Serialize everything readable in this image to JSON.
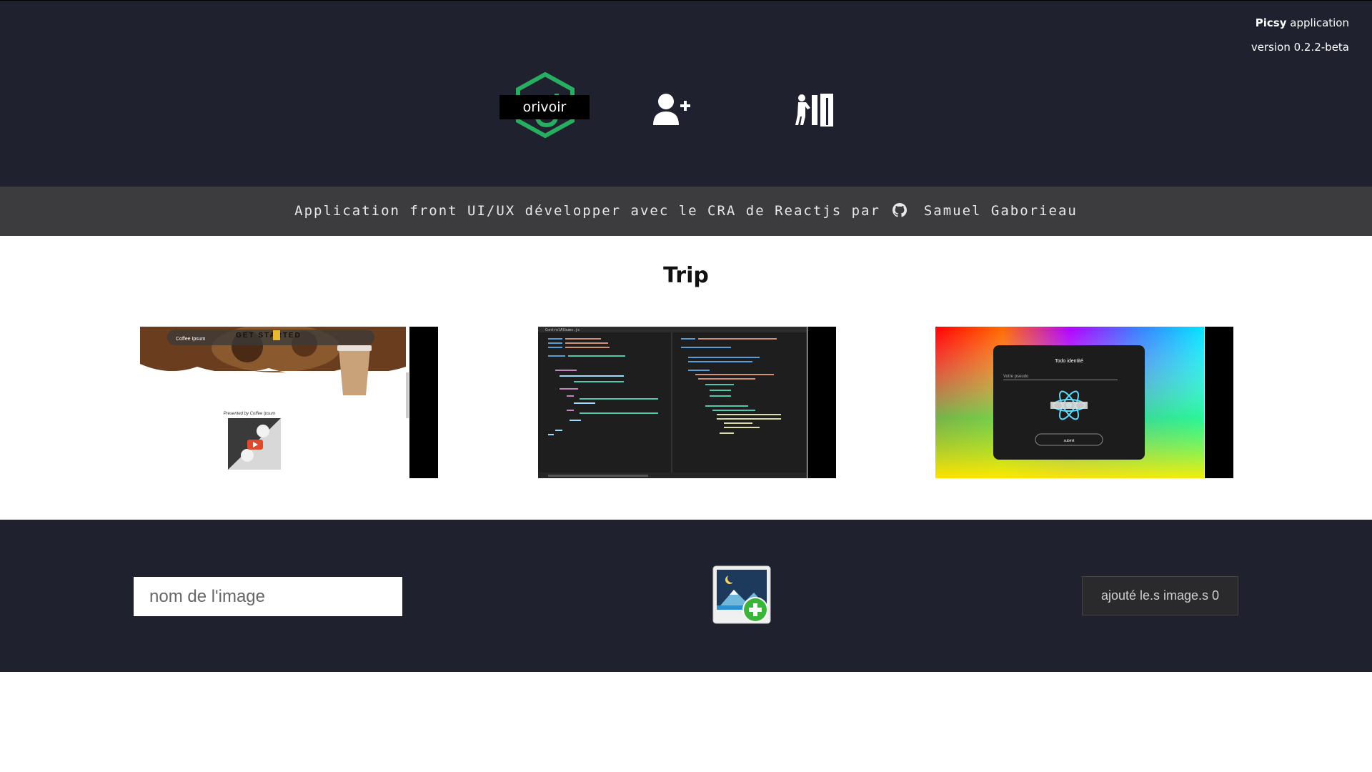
{
  "app": {
    "name": "Picsy",
    "name_suffix": " application",
    "version": "version 0.2.2-beta"
  },
  "nav": {
    "logo_label": "orivoir",
    "items": [
      {
        "icon": "add-user-icon"
      },
      {
        "icon": "logout-door-icon"
      }
    ]
  },
  "banner": {
    "text": "Application front UI/UX développer avec le CRA de Reactjs par",
    "author": "Samuel Gaborieau",
    "icon": "github-icon"
  },
  "album": {
    "title": "Trip",
    "photos": [
      {
        "subject": "coffee landing page",
        "heading": "GET STARTED",
        "brand": "Coffee Ipsum",
        "caption": "Presented by Coffee Ipsum"
      },
      {
        "subject": "code editor",
        "tab": "ControlAlbums.js"
      },
      {
        "subject": "identity form",
        "heading": "Todo identité",
        "field": "Votre pseudo",
        "button": "submit"
      }
    ]
  },
  "upload": {
    "placeholder": "nom de l'image",
    "add_icon": "add-image-icon",
    "submit_label": "ajouté le.s image.s 0"
  },
  "colors": {
    "header_bg": "#20212f",
    "banner_bg": "#3c3c3e",
    "accent_green": "#27ae60"
  }
}
